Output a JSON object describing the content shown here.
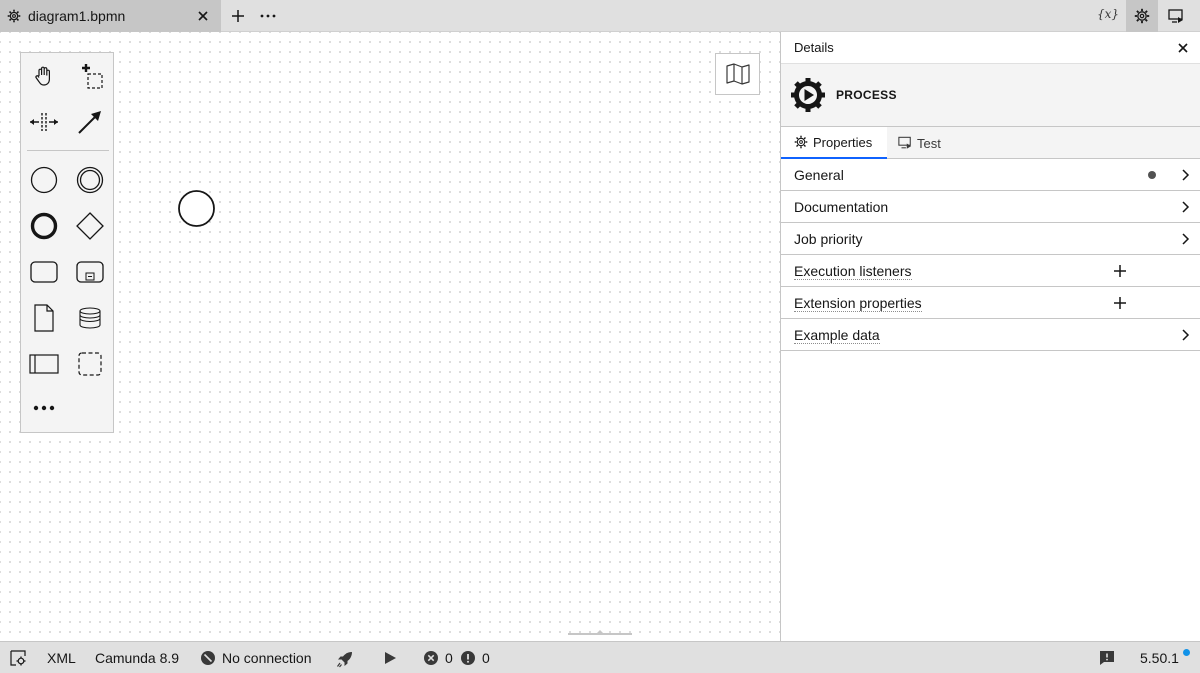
{
  "tab": {
    "title": "diagram1.bpmn"
  },
  "topbar": {
    "variables_label": "{x}"
  },
  "palette": {
    "tools": [
      {
        "icon": "hand-tool-icon"
      },
      {
        "icon": "lasso-tool-icon"
      },
      {
        "icon": "space-tool-icon"
      },
      {
        "icon": "global-connect-tool-icon"
      }
    ],
    "elements": [
      {
        "icon": "start-event-icon"
      },
      {
        "icon": "intermediate-event-icon"
      },
      {
        "icon": "end-event-icon"
      },
      {
        "icon": "gateway-icon"
      },
      {
        "icon": "task-icon"
      },
      {
        "icon": "subprocess-icon"
      },
      {
        "icon": "data-object-icon"
      },
      {
        "icon": "data-store-icon"
      },
      {
        "icon": "participant-icon"
      },
      {
        "icon": "group-icon"
      },
      {
        "icon": "more-elements-icon"
      }
    ]
  },
  "panel": {
    "title": "Details",
    "element_type": "PROCESS",
    "tabs": [
      {
        "label": "Properties",
        "active": true
      },
      {
        "label": "Test",
        "active": false
      }
    ],
    "groups": [
      {
        "label": "General",
        "action": "chevron",
        "has_data": true
      },
      {
        "label": "Documentation",
        "action": "chevron"
      },
      {
        "label": "Job priority",
        "action": "chevron"
      },
      {
        "label": "Execution listeners",
        "action": "add"
      },
      {
        "label": "Extension properties",
        "action": "add"
      },
      {
        "label": "Example data",
        "action": "chevron"
      }
    ]
  },
  "statusbar": {
    "xml_label": "XML",
    "engine_label": "Camunda 8.9",
    "connection_label": "No connection",
    "errors": "0",
    "warnings": "0",
    "version": "5.50.1"
  },
  "colors": {
    "accent": "#0f62fe",
    "update_dot": "#1192e8"
  }
}
